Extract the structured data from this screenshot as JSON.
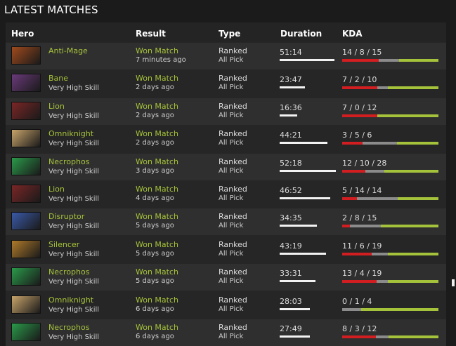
{
  "page": {
    "title": "LATEST MATCHES"
  },
  "table": {
    "headers": {
      "hero": "Hero",
      "result": "Result",
      "type": "Type",
      "duration": "Duration",
      "kda": "KDA"
    },
    "rows": [
      {
        "hero": "Anti-Mage",
        "skill": "",
        "result": "Won Match",
        "when": "7 minutes ago",
        "type": "Ranked",
        "mode": "All Pick",
        "duration": "51:14",
        "kda": "14 / 8 / 15",
        "k": 14,
        "d": 8,
        "a": 15,
        "avatar_color": "#a04a1c"
      },
      {
        "hero": "Bane",
        "skill": "Very High Skill",
        "result": "Won Match",
        "when": "2 days ago",
        "type": "Ranked",
        "mode": "All Pick",
        "duration": "23:47",
        "kda": "7 / 2 / 10",
        "k": 7,
        "d": 2,
        "a": 10,
        "avatar_color": "#6a3a7a"
      },
      {
        "hero": "Lion",
        "skill": "Very High Skill",
        "result": "Won Match",
        "when": "2 days ago",
        "type": "Ranked",
        "mode": "All Pick",
        "duration": "16:36",
        "kda": "7 / 0 / 12",
        "k": 7,
        "d": 0,
        "a": 12,
        "avatar_color": "#7a2626"
      },
      {
        "hero": "Omniknight",
        "skill": "Very High Skill",
        "result": "Won Match",
        "when": "2 days ago",
        "type": "Ranked",
        "mode": "All Pick",
        "duration": "44:21",
        "kda": "3 / 5 / 6",
        "k": 3,
        "d": 5,
        "a": 6,
        "avatar_color": "#c8a46a"
      },
      {
        "hero": "Necrophos",
        "skill": "Very High Skill",
        "result": "Won Match",
        "when": "3 days ago",
        "type": "Ranked",
        "mode": "All Pick",
        "duration": "52:18",
        "kda": "12 / 10 / 28",
        "k": 12,
        "d": 10,
        "a": 28,
        "avatar_color": "#2a9a4a"
      },
      {
        "hero": "Lion",
        "skill": "Very High Skill",
        "result": "Won Match",
        "when": "4 days ago",
        "type": "Ranked",
        "mode": "All Pick",
        "duration": "46:52",
        "kda": "5 / 14 / 14",
        "k": 5,
        "d": 14,
        "a": 14,
        "avatar_color": "#7a2626"
      },
      {
        "hero": "Disruptor",
        "skill": "Very High Skill",
        "result": "Won Match",
        "when": "5 days ago",
        "type": "Ranked",
        "mode": "All Pick",
        "duration": "34:35",
        "kda": "2 / 8 / 15",
        "k": 2,
        "d": 8,
        "a": 15,
        "avatar_color": "#3a5aa8"
      },
      {
        "hero": "Silencer",
        "skill": "Very High Skill",
        "result": "Won Match",
        "when": "5 days ago",
        "type": "Ranked",
        "mode": "All Pick",
        "duration": "43:19",
        "kda": "11 / 6 / 19",
        "k": 11,
        "d": 6,
        "a": 19,
        "avatar_color": "#b07a2a"
      },
      {
        "hero": "Necrophos",
        "skill": "Very High Skill",
        "result": "Won Match",
        "when": "5 days ago",
        "type": "Ranked",
        "mode": "All Pick",
        "duration": "33:31",
        "kda": "13 / 4 / 19",
        "k": 13,
        "d": 4,
        "a": 19,
        "avatar_color": "#2a9a4a"
      },
      {
        "hero": "Omniknight",
        "skill": "Very High Skill",
        "result": "Won Match",
        "when": "6 days ago",
        "type": "Ranked",
        "mode": "All Pick",
        "duration": "28:03",
        "kda": "0 / 1 / 4",
        "k": 0,
        "d": 1,
        "a": 4,
        "avatar_color": "#c8a46a"
      },
      {
        "hero": "Necrophos",
        "skill": "Very High Skill",
        "result": "Won Match",
        "when": "6 days ago",
        "type": "Ranked",
        "mode": "All Pick",
        "duration": "27:49",
        "kda": "8 / 3 / 12",
        "k": 8,
        "d": 3,
        "a": 12,
        "avatar_color": "#2a9a4a"
      }
    ]
  }
}
